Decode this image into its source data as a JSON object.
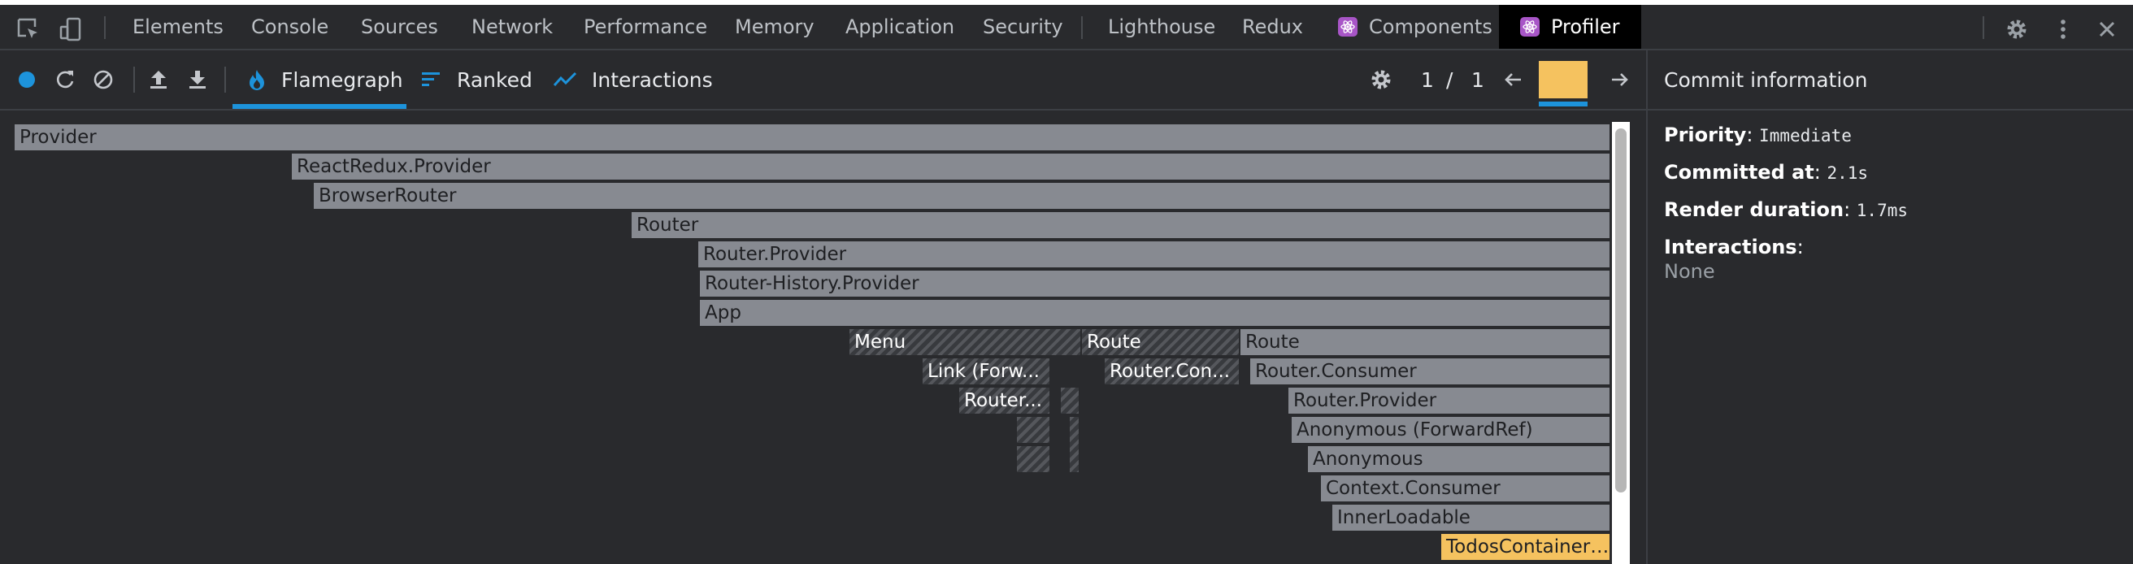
{
  "devtools_tabs": [
    "Elements",
    "Console",
    "Sources",
    "Network",
    "Performance",
    "Memory",
    "Application",
    "Security",
    "Lighthouse",
    "Redux"
  ],
  "react_tabs": {
    "components": "Components",
    "profiler": "Profiler"
  },
  "toolbar": {
    "views": [
      "Flamegraph",
      "Ranked",
      "Interactions"
    ],
    "commit_index": "1",
    "commit_sep": "/",
    "commit_total": "1"
  },
  "flamegraph": [
    {
      "label": "Provider",
      "style": "normal"
    },
    {
      "label": "ReactRedux.Provider",
      "style": "normal"
    },
    {
      "label": "BrowserRouter",
      "style": "normal"
    },
    {
      "label": "Router",
      "style": "normal"
    },
    {
      "label": "Router.Provider",
      "style": "normal"
    },
    {
      "label": "Router-History.Provider",
      "style": "normal"
    },
    {
      "label": "App",
      "style": "normal"
    },
    {
      "label": "Menu",
      "style": "hatch"
    },
    {
      "label": "Route",
      "style": "hatch"
    },
    {
      "label": "Route",
      "style": "normal"
    },
    {
      "label": "Link (Forw...",
      "style": "hatch"
    },
    {
      "label": "Router.Con...",
      "style": "hatch"
    },
    {
      "label": "Router.Consumer",
      "style": "normal"
    },
    {
      "label": "Router...",
      "style": "hatch"
    },
    {
      "label": "",
      "style": "hatch"
    },
    {
      "label": "Router.Provider",
      "style": "normal"
    },
    {
      "label": "",
      "style": "hatch"
    },
    {
      "label": "Anonymous (ForwardRef)",
      "style": "normal"
    },
    {
      "label": "",
      "style": "hatch"
    },
    {
      "label": "",
      "style": "hatch"
    },
    {
      "label": "Anonymous",
      "style": "normal"
    },
    {
      "label": "Context.Consumer",
      "style": "normal"
    },
    {
      "label": "InnerLoadable",
      "style": "normal"
    },
    {
      "label": "TodosContainer (...",
      "style": "selected"
    }
  ],
  "commit_info": {
    "title": "Commit information",
    "priority_label": "Priority",
    "priority_value": "Immediate",
    "committed_label": "Committed at",
    "committed_value": "2.1s",
    "duration_label": "Render duration",
    "duration_value": "1.7ms",
    "interactions_label": "Interactions",
    "interactions_value": "None"
  },
  "colors": {
    "accent": "#1d93db",
    "commit_bar": "#f5c25f",
    "bar": "#878a91",
    "react_badge": "#a855c7"
  },
  "icons": [
    "inspect-element-icon",
    "device-toolbar-icon",
    "record-icon",
    "reload-icon",
    "clear-icon",
    "upload-icon",
    "download-icon",
    "flame-icon",
    "ranked-icon",
    "interactions-icon",
    "settings-icon",
    "arrow-left-icon",
    "arrow-right-icon",
    "gear-icon",
    "more-vertical-icon",
    "close-icon"
  ]
}
